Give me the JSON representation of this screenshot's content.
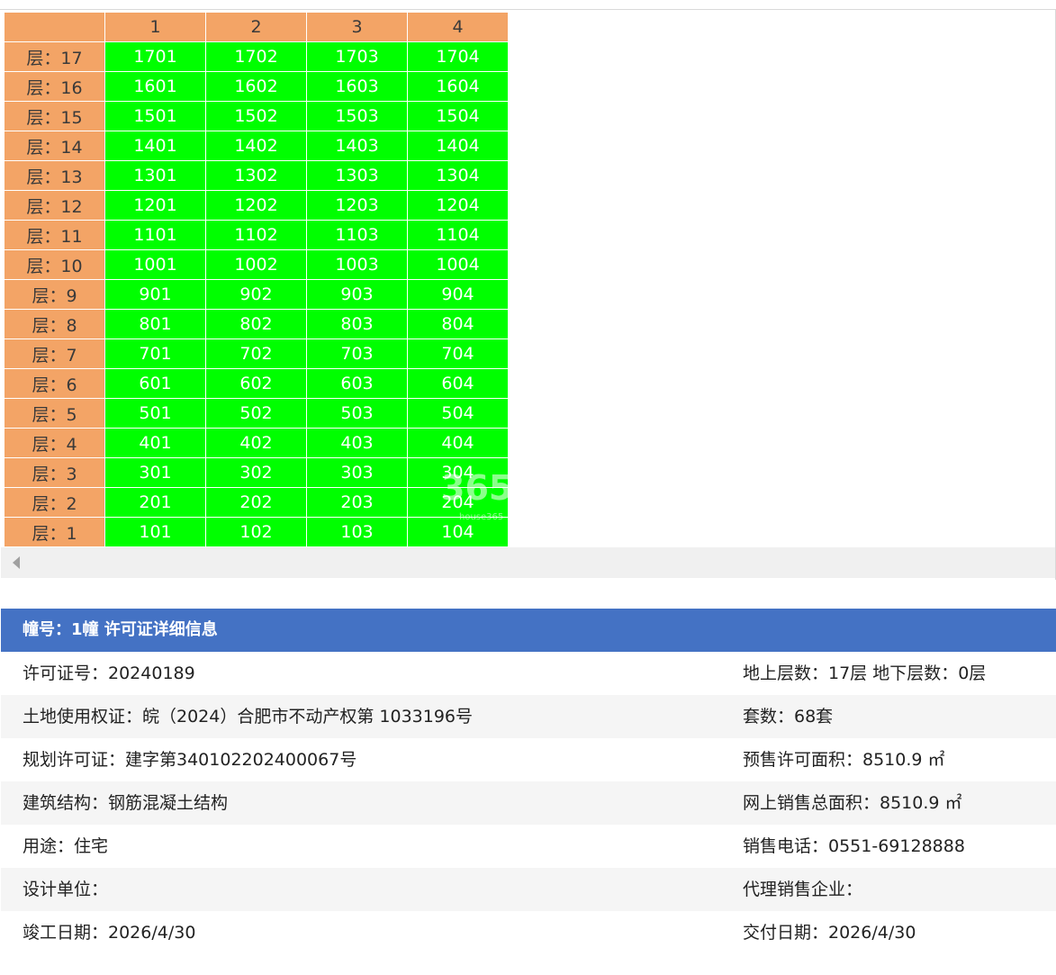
{
  "grid": {
    "columns": [
      "1",
      "2",
      "3",
      "4"
    ],
    "rows": [
      {
        "floor": "层：17",
        "units": [
          "1701",
          "1702",
          "1703",
          "1704"
        ]
      },
      {
        "floor": "层：16",
        "units": [
          "1601",
          "1602",
          "1603",
          "1604"
        ]
      },
      {
        "floor": "层：15",
        "units": [
          "1501",
          "1502",
          "1503",
          "1504"
        ]
      },
      {
        "floor": "层：14",
        "units": [
          "1401",
          "1402",
          "1403",
          "1404"
        ]
      },
      {
        "floor": "层：13",
        "units": [
          "1301",
          "1302",
          "1303",
          "1304"
        ]
      },
      {
        "floor": "层：12",
        "units": [
          "1201",
          "1202",
          "1203",
          "1204"
        ]
      },
      {
        "floor": "层：11",
        "units": [
          "1101",
          "1102",
          "1103",
          "1104"
        ]
      },
      {
        "floor": "层：10",
        "units": [
          "1001",
          "1002",
          "1003",
          "1004"
        ]
      },
      {
        "floor": "层：9",
        "units": [
          "901",
          "902",
          "903",
          "904"
        ]
      },
      {
        "floor": "层：8",
        "units": [
          "801",
          "802",
          "803",
          "804"
        ]
      },
      {
        "floor": "层：7",
        "units": [
          "701",
          "702",
          "703",
          "704"
        ]
      },
      {
        "floor": "层：6",
        "units": [
          "601",
          "602",
          "603",
          "604"
        ]
      },
      {
        "floor": "层：5",
        "units": [
          "501",
          "502",
          "503",
          "504"
        ]
      },
      {
        "floor": "层：4",
        "units": [
          "401",
          "402",
          "403",
          "404"
        ]
      },
      {
        "floor": "层：3",
        "units": [
          "301",
          "302",
          "303",
          "304"
        ]
      },
      {
        "floor": "层：2",
        "units": [
          "201",
          "202",
          "203",
          "204"
        ]
      },
      {
        "floor": "层：1",
        "units": [
          "101",
          "102",
          "103",
          "104"
        ]
      }
    ],
    "watermark": "365",
    "watermark_sub": "house365"
  },
  "colors": {
    "header_bg": "#f3a466",
    "unit_bg": "#00ff00",
    "info_header_bg": "#4472c4"
  },
  "info": {
    "header": "幢号：1幢 许可证详细信息",
    "rows": [
      {
        "left": "许可证号：20240189",
        "right": "地上层数：17层  地下层数：0层"
      },
      {
        "left": "土地使用权证：皖（2024）合肥市不动产权第 1033196号",
        "right": "套数：68套"
      },
      {
        "left": "规划许可证：建字第340102202400067号",
        "right": "预售许可面积：8510.9 ㎡"
      },
      {
        "left": "建筑结构：钢筋混凝土结构",
        "right": "网上销售总面积：8510.9 ㎡"
      },
      {
        "left": "用途：住宅",
        "right": "销售电话：0551-69128888"
      },
      {
        "left": "设计单位：",
        "right": "代理销售企业："
      },
      {
        "left": "竣工日期：2026/4/30",
        "right": "交付日期：2026/4/30"
      }
    ]
  }
}
